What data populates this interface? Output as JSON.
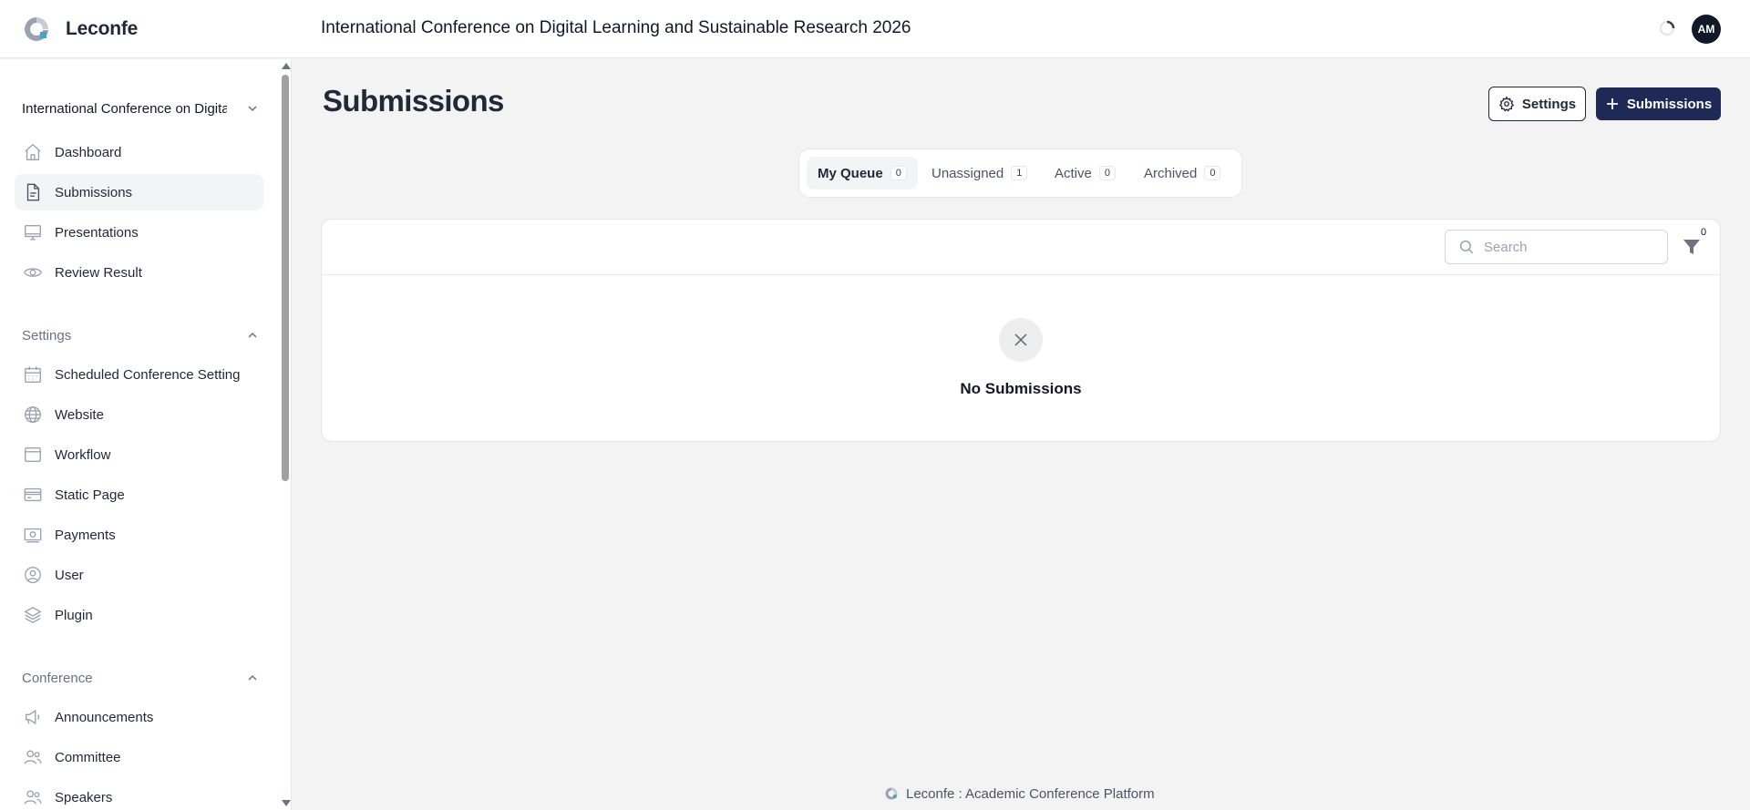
{
  "app": {
    "brand_name": "Leconfe",
    "conference_title": "International Conference on Digital Learning and Sustainable Research 2026",
    "user_initials": "AM",
    "footer_text": "Leconfe : Academic Conference Platform"
  },
  "sidebar": {
    "conference_selector": "International Conference on Digital Learning and Sustainable Research 2026",
    "items": [
      {
        "label": "Dashboard",
        "icon": "home-icon",
        "active": false
      },
      {
        "label": "Submissions",
        "icon": "document-icon",
        "active": true
      },
      {
        "label": "Presentations",
        "icon": "monitor-icon",
        "active": false
      },
      {
        "label": "Review Result",
        "icon": "eye-icon",
        "active": false
      }
    ],
    "groups": [
      {
        "label": "Settings",
        "expanded": true,
        "items": [
          {
            "label": "Scheduled Conference Setting",
            "icon": "calendar-icon"
          },
          {
            "label": "Website",
            "icon": "globe-icon"
          },
          {
            "label": "Workflow",
            "icon": "window-icon"
          },
          {
            "label": "Static Page",
            "icon": "card-icon"
          },
          {
            "label": "Payments",
            "icon": "cash-icon"
          },
          {
            "label": "User",
            "icon": "user-circle-icon"
          },
          {
            "label": "Plugin",
            "icon": "layers-icon"
          }
        ]
      },
      {
        "label": "Conference",
        "expanded": true,
        "items": [
          {
            "label": "Announcements",
            "icon": "megaphone-icon"
          },
          {
            "label": "Committee",
            "icon": "users-icon"
          },
          {
            "label": "Speakers",
            "icon": "users-icon"
          }
        ]
      }
    ]
  },
  "main": {
    "title": "Submissions",
    "settings_button": "Settings",
    "new_button": "Submissions",
    "tabs": [
      {
        "label": "My Queue",
        "count": "0",
        "active": true
      },
      {
        "label": "Unassigned",
        "count": "1",
        "active": false
      },
      {
        "label": "Active",
        "count": "0",
        "active": false
      },
      {
        "label": "Archived",
        "count": "0",
        "active": false
      }
    ],
    "search": {
      "placeholder": "Search",
      "value": ""
    },
    "filter_count": "0",
    "empty_message": "No Submissions"
  },
  "colors": {
    "primary": "#1e2a55",
    "logo_accent": "#3aa6d8",
    "background": "#f3f3f3"
  }
}
